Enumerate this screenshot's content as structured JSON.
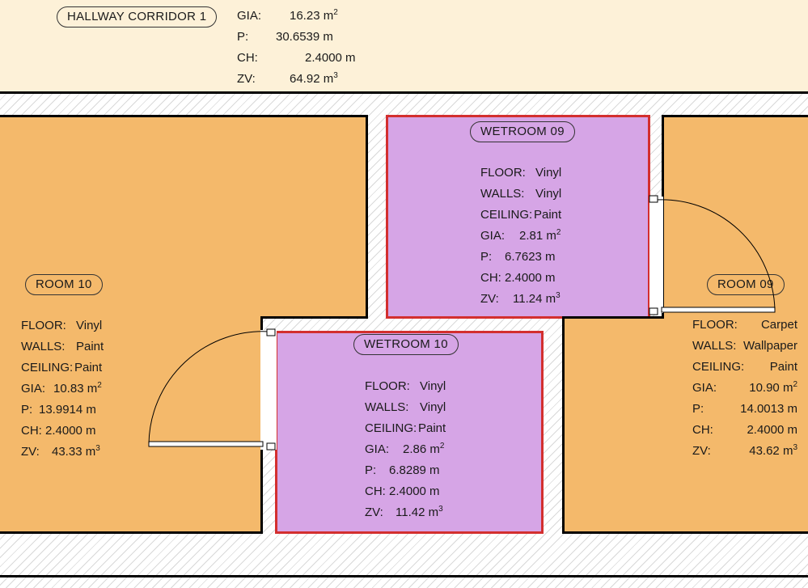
{
  "colors": {
    "corridor_fill": "#fdf1d8",
    "room_fill": "#f4b96b",
    "wetroom_fill": "#d6a5e6",
    "selected_outline": "#d32f2f",
    "wall": "#000000"
  },
  "rooms": {
    "hallway_corridor_1": {
      "name": "HALLWAY CORRIDOR 1",
      "gia_label": "GIA:",
      "gia_value": "16.23 m",
      "gia_unit_sup": "2",
      "p_label": "P:",
      "p_value": "30.6539 m",
      "ch_label": "CH:",
      "ch_value": "2.4000 m",
      "zv_label": "ZV:",
      "zv_value": "64.92 m",
      "zv_unit_sup": "3"
    },
    "room_10": {
      "name": "ROOM 10",
      "floor_label": "FLOOR:",
      "floor_value": "Vinyl",
      "walls_label": "WALLS:",
      "walls_value": "Paint",
      "ceiling_label": "CEILING:",
      "ceiling_value": "Paint",
      "gia_label": "GIA:",
      "gia_value": "10.83 m",
      "gia_unit_sup": "2",
      "p_label": "P:",
      "p_value": "13.9914 m",
      "ch_label": "CH:",
      "ch_value": "2.4000 m",
      "zv_label": "ZV:",
      "zv_value": "43.33 m",
      "zv_unit_sup": "3"
    },
    "wetroom_09": {
      "name": "WETROOM 09",
      "floor_label": "FLOOR:",
      "floor_value": "Vinyl",
      "walls_label": "WALLS:",
      "walls_value": "Vinyl",
      "ceiling_label": "CEILING:",
      "ceiling_value": "Paint",
      "gia_label": "GIA:",
      "gia_value": "2.81 m",
      "gia_unit_sup": "2",
      "p_label": "P:",
      "p_value": "6.7623 m",
      "ch_label": "CH:",
      "ch_value": "2.4000 m",
      "zv_label": "ZV:",
      "zv_value": "11.24 m",
      "zv_unit_sup": "3"
    },
    "wetroom_10": {
      "name": "WETROOM 10",
      "floor_label": "FLOOR:",
      "floor_value": "Vinyl",
      "walls_label": "WALLS:",
      "walls_value": "Vinyl",
      "ceiling_label": "CEILING:",
      "ceiling_value": "Paint",
      "gia_label": "GIA:",
      "gia_value": "2.86 m",
      "gia_unit_sup": "2",
      "p_label": "P:",
      "p_value": "6.8289 m",
      "ch_label": "CH:",
      "ch_value": "2.4000 m",
      "zv_label": "ZV:",
      "zv_value": "11.42 m",
      "zv_unit_sup": "3"
    },
    "room_09": {
      "name": "ROOM 09",
      "floor_label": "FLOOR:",
      "floor_value": "Carpet",
      "walls_label": "WALLS:",
      "walls_value": "Wallpaper",
      "ceiling_label": "CEILING:",
      "ceiling_value": "Paint",
      "gia_label": "GIA:",
      "gia_value": "10.90 m",
      "gia_unit_sup": "2",
      "p_label": "P:",
      "p_value": "14.0013 m",
      "ch_label": "CH:",
      "ch_value": "2.4000 m",
      "zv_label": "ZV:",
      "zv_value": "43.62 m",
      "zv_unit_sup": "3"
    }
  }
}
